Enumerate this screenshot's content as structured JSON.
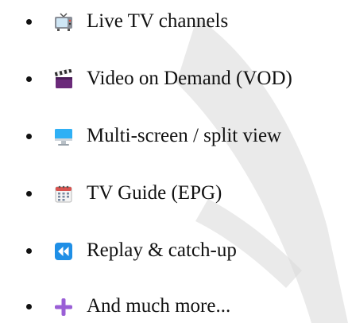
{
  "features": [
    {
      "label": "Live TV channels",
      "icon": "tv-icon"
    },
    {
      "label": "Video on Demand (VOD)",
      "icon": "clapperboard-icon"
    },
    {
      "label": "Multi-screen / split view",
      "icon": "desktop-monitor-icon"
    },
    {
      "label": "TV Guide (EPG)",
      "icon": "calendar-icon"
    },
    {
      "label": "Replay & catch-up",
      "icon": "rewind-icon"
    },
    {
      "label": "And much more...",
      "icon": "plus-icon"
    }
  ],
  "colors": {
    "text": "#111111",
    "background": "#ffffff",
    "watermark": "#d9d9d9",
    "rewind_accent": "#1f8fe6",
    "plus_accent": "#9a5fd6",
    "monitor_accent": "#2fb0f5"
  }
}
